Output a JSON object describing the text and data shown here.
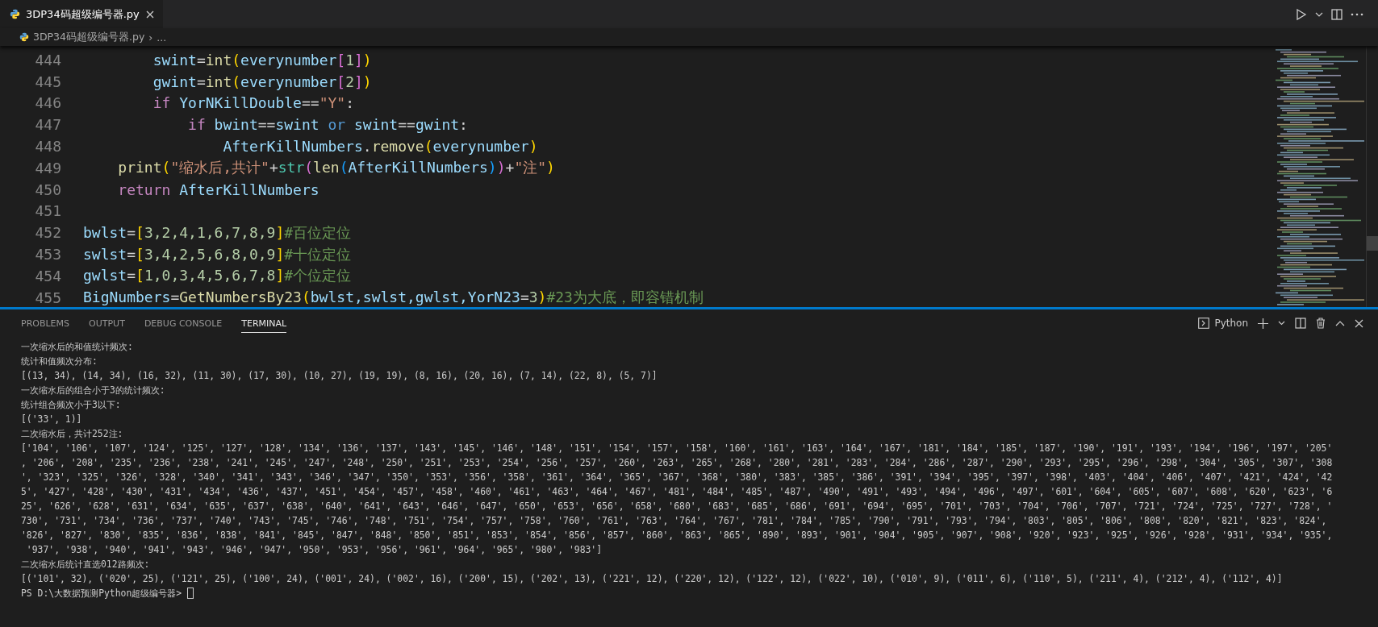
{
  "editor_tab": {
    "label": "3DP34码超级编号器.py",
    "selected": true
  },
  "breadcrumb": {
    "file": "3DP34码超级编号器.py",
    "separator": "›",
    "rest": "..."
  },
  "code_lines": [
    {
      "number": "444",
      "tokens": [
        {
          "kind": "var",
          "text": "        swint"
        },
        {
          "kind": "op",
          "text": "="
        },
        {
          "kind": "fn",
          "text": "int"
        },
        {
          "kind": "br1",
          "text": "("
        },
        {
          "kind": "var",
          "text": "everynumber"
        },
        {
          "kind": "br2",
          "text": "["
        },
        {
          "kind": "num",
          "text": "1"
        },
        {
          "kind": "br2",
          "text": "]"
        },
        {
          "kind": "br1",
          "text": ")"
        }
      ]
    },
    {
      "number": "445",
      "tokens": [
        {
          "kind": "var",
          "text": "        gwint"
        },
        {
          "kind": "op",
          "text": "="
        },
        {
          "kind": "fn",
          "text": "int"
        },
        {
          "kind": "br1",
          "text": "("
        },
        {
          "kind": "var",
          "text": "everynumber"
        },
        {
          "kind": "br2",
          "text": "["
        },
        {
          "kind": "num",
          "text": "2"
        },
        {
          "kind": "br2",
          "text": "]"
        },
        {
          "kind": "br1",
          "text": ")"
        }
      ]
    },
    {
      "number": "446",
      "tokens": [
        {
          "kind": "kw",
          "text": "        if"
        },
        {
          "kind": "var",
          "text": " YorNKillDouble"
        },
        {
          "kind": "op",
          "text": "=="
        },
        {
          "kind": "str",
          "text": "\"Y\""
        },
        {
          "kind": "op",
          "text": ":"
        }
      ]
    },
    {
      "number": "447",
      "tokens": [
        {
          "kind": "kw",
          "text": "            if"
        },
        {
          "kind": "var",
          "text": " bwint"
        },
        {
          "kind": "op",
          "text": "=="
        },
        {
          "kind": "var",
          "text": "swint "
        },
        {
          "kind": "kw2",
          "text": "or"
        },
        {
          "kind": "var",
          "text": " swint"
        },
        {
          "kind": "op",
          "text": "=="
        },
        {
          "kind": "var",
          "text": "gwint"
        },
        {
          "kind": "op",
          "text": ":"
        }
      ]
    },
    {
      "number": "448",
      "tokens": [
        {
          "kind": "var",
          "text": "                AfterKillNumbers"
        },
        {
          "kind": "op",
          "text": "."
        },
        {
          "kind": "fn",
          "text": "remove"
        },
        {
          "kind": "br1",
          "text": "("
        },
        {
          "kind": "var",
          "text": "everynumber"
        },
        {
          "kind": "br1",
          "text": ")"
        }
      ]
    },
    {
      "number": "449",
      "tokens": [
        {
          "kind": "fn",
          "text": "    print"
        },
        {
          "kind": "br1",
          "text": "("
        },
        {
          "kind": "str",
          "text": "\"缩水后,共计\""
        },
        {
          "kind": "op",
          "text": "+"
        },
        {
          "kind": "type",
          "text": "str"
        },
        {
          "kind": "br2",
          "text": "("
        },
        {
          "kind": "fn",
          "text": "len"
        },
        {
          "kind": "br3",
          "text": "("
        },
        {
          "kind": "var",
          "text": "AfterKillNumbers"
        },
        {
          "kind": "br3",
          "text": ")"
        },
        {
          "kind": "br2",
          "text": ")"
        },
        {
          "kind": "op",
          "text": "+"
        },
        {
          "kind": "str",
          "text": "\"注\""
        },
        {
          "kind": "br1",
          "text": ")"
        }
      ]
    },
    {
      "number": "450",
      "tokens": [
        {
          "kind": "kw",
          "text": "    return"
        },
        {
          "kind": "var",
          "text": " AfterKillNumbers"
        }
      ]
    },
    {
      "number": "451"
    },
    {
      "number": "452",
      "tokens": [
        {
          "kind": "var",
          "text": "bwlst"
        },
        {
          "kind": "op",
          "text": "="
        },
        {
          "kind": "br1",
          "text": "["
        },
        {
          "kind": "num",
          "text": "3,2,4,1,6,7,8,9"
        },
        {
          "kind": "br1",
          "text": "]"
        },
        {
          "kind": "cm",
          "text": "#百位定位"
        }
      ]
    },
    {
      "number": "453",
      "tokens": [
        {
          "kind": "var",
          "text": "swlst"
        },
        {
          "kind": "op",
          "text": "="
        },
        {
          "kind": "br1",
          "text": "["
        },
        {
          "kind": "num",
          "text": "3,4,2,5,6,8,0,9"
        },
        {
          "kind": "br1",
          "text": "]"
        },
        {
          "kind": "cm",
          "text": "#十位定位"
        }
      ]
    },
    {
      "number": "454",
      "tokens": [
        {
          "kind": "var",
          "text": "gwlst"
        },
        {
          "kind": "op",
          "text": "="
        },
        {
          "kind": "br1",
          "text": "["
        },
        {
          "kind": "num",
          "text": "1,0,3,4,5,6,7,8"
        },
        {
          "kind": "br1",
          "text": "]"
        },
        {
          "kind": "cm",
          "text": "#个位定位"
        }
      ]
    },
    {
      "number": "455",
      "tokens": [
        {
          "kind": "var",
          "text": "BigNumbers"
        },
        {
          "kind": "op",
          "text": "="
        },
        {
          "kind": "fn",
          "text": "GetNumbersBy23"
        },
        {
          "kind": "br1",
          "text": "("
        },
        {
          "kind": "var",
          "text": "bwlst,swlst,gwlst,YorN23"
        },
        {
          "kind": "op",
          "text": "="
        },
        {
          "kind": "num",
          "text": "3"
        },
        {
          "kind": "br1",
          "text": ")"
        },
        {
          "kind": "cm",
          "text": "#23为大底，即容错机制"
        }
      ]
    }
  ],
  "panel_tabs": [
    {
      "label": "PROBLEMS",
      "selected": false
    },
    {
      "label": "OUTPUT",
      "selected": false
    },
    {
      "label": "DEBUG CONSOLE",
      "selected": false
    },
    {
      "label": "TERMINAL",
      "selected": true
    }
  ],
  "terminal_profile": "Python",
  "terminal_lines": [
    "一次缩水后的和值统计频次:",
    "统计和值频次分布:",
    "[(13, 34), (14, 34), (16, 32), (11, 30), (17, 30), (10, 27), (19, 19), (8, 16), (20, 16), (7, 14), (22, 8), (5, 7)]",
    "一次缩水后的组合小于3的统计频次:",
    "统计组合频次小于3以下:",
    "[('33', 1)]",
    "二次缩水后，共计252注:",
    "['104', '106', '107', '124', '125', '127', '128', '134', '136', '137', '143', '145', '146', '148', '151', '154', '157', '158', '160', '161', '163', '164', '167', '181', '184', '185', '187', '190', '191', '193', '194', '196', '197', '205'",
    ", '206', '208', '235', '236', '238', '241', '245', '247', '248', '250', '251', '253', '254', '256', '257', '260', '263', '265', '268', '280', '281', '283', '284', '286', '287', '290', '293', '295', '296', '298', '304', '305', '307', '308",
    "', '323', '325', '326', '328', '340', '341', '343', '346', '347', '350', '353', '356', '358', '361', '364', '365', '367', '368', '380', '383', '385', '386', '391', '394', '395', '397', '398', '403', '404', '406', '407', '421', '424', '42",
    "5', '427', '428', '430', '431', '434', '436', '437', '451', '454', '457', '458', '460', '461', '463', '464', '467', '481', '484', '485', '487', '490', '491', '493', '494', '496', '497', '601', '604', '605', '607', '608', '620', '623', '6",
    "25', '626', '628', '631', '634', '635', '637', '638', '640', '641', '643', '646', '647', '650', '653', '656', '658', '680', '683', '685', '686', '691', '694', '695', '701', '703', '704', '706', '707', '721', '724', '725', '727', '728', '",
    "730', '731', '734', '736', '737', '740', '743', '745', '746', '748', '751', '754', '757', '758', '760', '761', '763', '764', '767', '781', '784', '785', '790', '791', '793', '794', '803', '805', '806', '808', '820', '821', '823', '824',",
    "'826', '827', '830', '835', '836', '838', '841', '845', '847', '848', '850', '851', '853', '854', '856', '857', '860', '863', '865', '890', '893', '901', '904', '905', '907', '908', '920', '923', '925', '926', '928', '931', '934', '935',",
    " '937', '938', '940', '941', '943', '946', '947', '950', '953', '956', '961', '964', '965', '980', '983']",
    "二次缩水后统计直选012路频次:",
    "[('101', 32), ('020', 25), ('121', 25), ('100', 24), ('001', 24), ('002', 16), ('200', 15), ('202', 13), ('221', 12), ('220', 12), ('122', 12), ('022', 10), ('010', 9), ('011', 6), ('110', 5), ('211', 4), ('212', 4), ('112', 4)]"
  ],
  "prompt": "PS D:\\大数据预测Python超级编号器> "
}
